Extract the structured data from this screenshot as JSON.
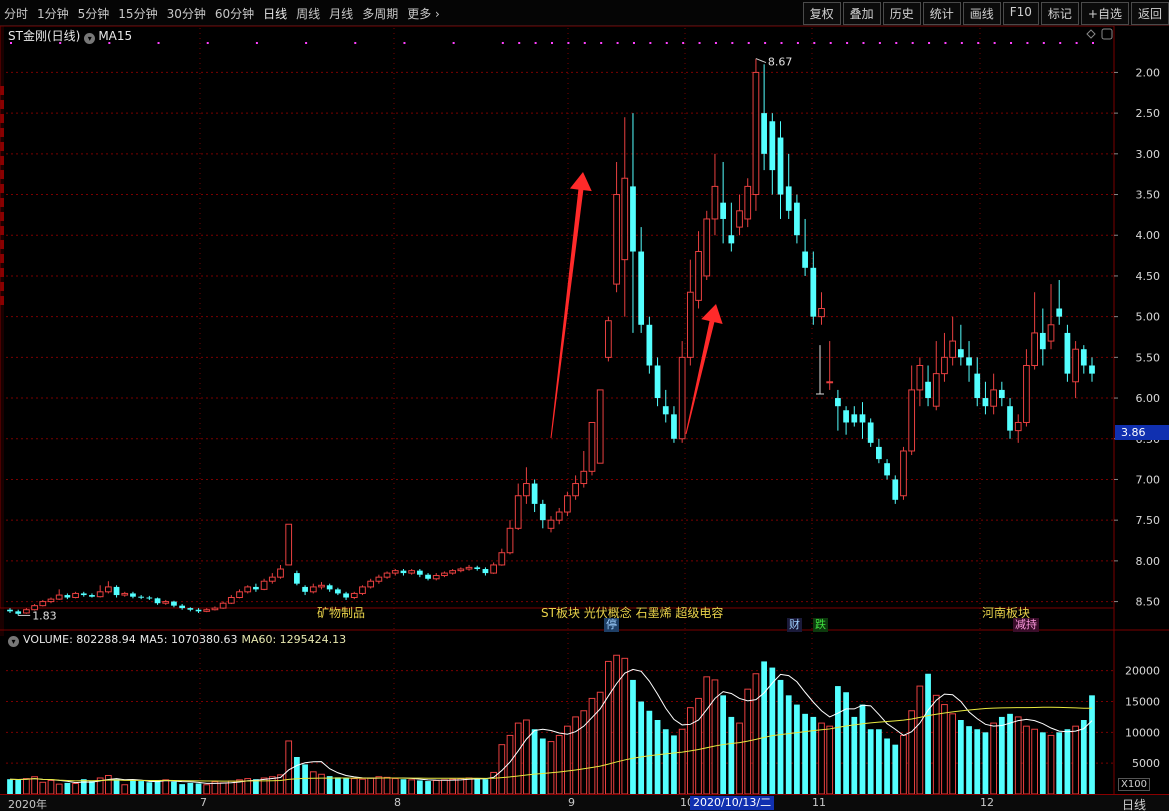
{
  "toolbar": {
    "periods": [
      "分时",
      "1分钟",
      "5分钟",
      "15分钟",
      "30分钟",
      "60分钟",
      "日线",
      "周线",
      "月线",
      "多周期",
      "更多"
    ],
    "active_period": "日线",
    "right_tabs": [
      "复权",
      "叠加",
      "历史",
      "统计",
      "画线",
      "F10",
      "标记",
      "+自选",
      "返回"
    ]
  },
  "price_panel": {
    "stock_title": "ST金刚(日线)",
    "indicator": "MA15",
    "high_label": "8.67",
    "low_label": "1.83",
    "current_price_tag": "3.86",
    "y_ticks": [
      "8.50",
      "8.00",
      "7.50",
      "7.00",
      "6.50",
      "6.00",
      "5.50",
      "5.00",
      "4.50",
      "4.00",
      "3.50",
      "3.00",
      "2.50",
      "2.00"
    ],
    "annotations": {
      "sector1": "矿物制品",
      "sector2": "ST板块 光伏概念 石墨烯 超级电容",
      "sector3": "河南板块"
    },
    "event_chips": {
      "stop": "停",
      "finance": "财",
      "fall": "跌",
      "reduce": "减持"
    }
  },
  "volume_panel": {
    "volume_label": "VOLUME: 802288.94",
    "ma5_label": "MA5: 1070380.63",
    "ma60_label": "MA60: 1295424.13",
    "y_ticks": [
      "20000",
      "15000",
      "10000",
      "5000"
    ],
    "unit": "X100"
  },
  "bottom_bar": {
    "x_labels": [
      "2020年",
      "7",
      "8",
      "9",
      "10",
      "11",
      "12"
    ],
    "cursor_date": "2020/10/13/二",
    "period_label": "日线"
  },
  "colors": {
    "up": "#e84040",
    "down": "#54ffff",
    "ma_line": "#ffffff",
    "ma60_line": "#e8e840",
    "arrow": "#ff2a2a",
    "grid": "#7a0000"
  },
  "chart_data": [
    {
      "type": "candlestick",
      "title": "ST金刚(日线)",
      "ylim": [
        1.7,
        8.8
      ],
      "y_ticks": [
        2.0,
        2.5,
        3.0,
        3.5,
        4.0,
        4.5,
        5.0,
        5.5,
        6.0,
        6.5,
        7.0,
        7.5,
        8.0,
        8.5
      ],
      "date_labels": [
        "2020年",
        "7",
        "8",
        "9",
        "10",
        "11",
        "12"
      ],
      "candles": [
        [
          1.9,
          1.88,
          1.92,
          1.86
        ],
        [
          1.88,
          1.85,
          1.9,
          1.83
        ],
        [
          1.86,
          1.9,
          1.92,
          1.85
        ],
        [
          1.9,
          1.95,
          1.97,
          1.89
        ],
        [
          1.95,
          2.0,
          2.02,
          1.94
        ],
        [
          2.0,
          2.03,
          2.05,
          1.98
        ],
        [
          2.03,
          2.08,
          2.15,
          2.02
        ],
        [
          2.08,
          2.05,
          2.1,
          2.03
        ],
        [
          2.05,
          2.1,
          2.12,
          2.04
        ],
        [
          2.1,
          2.08,
          2.12,
          2.06
        ],
        [
          2.08,
          2.06,
          2.1,
          2.05
        ],
        [
          2.06,
          2.12,
          2.2,
          2.05
        ],
        [
          2.12,
          2.18,
          2.25,
          2.1
        ],
        [
          2.18,
          2.08,
          2.2,
          2.05
        ],
        [
          2.08,
          2.1,
          2.12,
          2.06
        ],
        [
          2.1,
          2.06,
          2.12,
          2.04
        ],
        [
          2.06,
          2.05,
          2.08,
          2.03
        ],
        [
          2.05,
          2.04,
          2.07,
          2.02
        ],
        [
          2.04,
          1.98,
          2.05,
          1.96
        ],
        [
          1.98,
          2.0,
          2.02,
          1.96
        ],
        [
          2.0,
          1.95,
          2.01,
          1.93
        ],
        [
          1.95,
          1.92,
          1.97,
          1.9
        ],
        [
          1.92,
          1.9,
          1.93,
          1.88
        ],
        [
          1.9,
          1.88,
          1.92,
          1.86
        ],
        [
          1.88,
          1.9,
          1.92,
          1.87
        ],
        [
          1.9,
          1.92,
          1.94,
          1.89
        ],
        [
          1.92,
          1.98,
          2.0,
          1.91
        ],
        [
          1.98,
          2.05,
          2.08,
          1.97
        ],
        [
          2.05,
          2.12,
          2.15,
          2.04
        ],
        [
          2.12,
          2.18,
          2.2,
          2.1
        ],
        [
          2.18,
          2.15,
          2.22,
          2.12
        ],
        [
          2.15,
          2.25,
          2.28,
          2.14
        ],
        [
          2.25,
          2.3,
          2.35,
          2.22
        ],
        [
          2.3,
          2.4,
          2.45,
          2.28
        ],
        [
          2.45,
          2.95,
          2.95,
          2.45
        ],
        [
          2.35,
          2.22,
          2.38,
          2.2
        ],
        [
          2.18,
          2.12,
          2.2,
          2.08
        ],
        [
          2.12,
          2.18,
          2.22,
          2.1
        ],
        [
          2.18,
          2.2,
          2.24,
          2.15
        ],
        [
          2.2,
          2.15,
          2.22,
          2.12
        ],
        [
          2.15,
          2.1,
          2.17,
          2.08
        ],
        [
          2.1,
          2.05,
          2.12,
          2.02
        ],
        [
          2.05,
          2.1,
          2.12,
          2.03
        ],
        [
          2.1,
          2.18,
          2.2,
          2.08
        ],
        [
          2.18,
          2.25,
          2.28,
          2.16
        ],
        [
          2.25,
          2.3,
          2.33,
          2.22
        ],
        [
          2.3,
          2.35,
          2.37,
          2.28
        ],
        [
          2.35,
          2.38,
          2.4,
          2.32
        ],
        [
          2.38,
          2.35,
          2.4,
          2.32
        ],
        [
          2.35,
          2.38,
          2.4,
          2.33
        ],
        [
          2.38,
          2.33,
          2.4,
          2.3
        ],
        [
          2.33,
          2.28,
          2.35,
          2.26
        ],
        [
          2.28,
          2.32,
          2.35,
          2.26
        ],
        [
          2.32,
          2.35,
          2.37,
          2.3
        ],
        [
          2.35,
          2.38,
          2.4,
          2.33
        ],
        [
          2.38,
          2.4,
          2.42,
          2.36
        ],
        [
          2.4,
          2.42,
          2.45,
          2.38
        ],
        [
          2.42,
          2.4,
          2.44,
          2.38
        ],
        [
          2.4,
          2.35,
          2.42,
          2.32
        ],
        [
          2.35,
          2.45,
          2.48,
          2.34
        ],
        [
          2.45,
          2.6,
          2.65,
          2.44
        ],
        [
          2.6,
          2.9,
          3.0,
          2.58
        ],
        [
          2.9,
          3.3,
          3.45,
          2.88
        ],
        [
          3.3,
          3.45,
          3.65,
          3.2
        ],
        [
          3.45,
          3.2,
          3.5,
          3.1
        ],
        [
          3.2,
          3.0,
          3.25,
          2.9
        ],
        [
          2.9,
          3.0,
          3.05,
          2.85
        ],
        [
          3.0,
          3.1,
          3.15,
          2.95
        ],
        [
          3.1,
          3.3,
          3.35,
          3.05
        ],
        [
          3.3,
          3.45,
          3.55,
          3.25
        ],
        [
          3.45,
          3.6,
          3.85,
          3.4
        ],
        [
          3.6,
          4.2,
          4.2,
          3.55
        ],
        [
          3.7,
          4.6,
          4.6,
          3.7
        ],
        [
          5.0,
          5.45,
          5.5,
          4.95
        ],
        [
          5.9,
          7.0,
          7.4,
          5.8
        ],
        [
          6.2,
          7.2,
          7.95,
          5.5
        ],
        [
          7.1,
          6.3,
          8.0,
          5.3
        ],
        [
          6.3,
          5.4,
          6.6,
          5.3
        ],
        [
          5.4,
          4.9,
          5.5,
          4.8
        ],
        [
          4.9,
          4.5,
          5.0,
          4.4
        ],
        [
          4.4,
          4.3,
          4.6,
          4.2
        ],
        [
          4.3,
          4.0,
          4.4,
          3.95
        ],
        [
          4.0,
          5.0,
          5.2,
          3.95
        ],
        [
          5.0,
          5.8,
          6.2,
          4.9
        ],
        [
          5.7,
          6.3,
          6.55,
          5.6
        ],
        [
          6.0,
          6.7,
          6.8,
          5.95
        ],
        [
          6.7,
          7.1,
          7.5,
          6.5
        ],
        [
          6.9,
          6.7,
          7.4,
          6.4
        ],
        [
          6.5,
          6.4,
          6.9,
          6.3
        ],
        [
          6.6,
          6.8,
          7.0,
          6.5
        ],
        [
          6.7,
          7.1,
          7.2,
          6.6
        ],
        [
          7.0,
          8.5,
          8.67,
          6.8
        ],
        [
          8.0,
          7.5,
          8.6,
          7.3
        ],
        [
          7.9,
          7.3,
          8.0,
          7.0
        ],
        [
          7.7,
          7.0,
          7.9,
          6.7
        ],
        [
          7.1,
          6.8,
          7.5,
          6.7
        ],
        [
          6.9,
          6.5,
          7.0,
          6.4
        ],
        [
          6.3,
          6.1,
          6.7,
          6.0
        ],
        [
          6.1,
          5.5,
          6.3,
          5.4
        ],
        [
          5.5,
          5.6,
          5.8,
          5.4
        ],
        [
          4.7,
          4.7,
          5.2,
          4.6
        ],
        [
          4.5,
          4.4,
          4.6,
          4.1
        ],
        [
          4.35,
          4.2,
          4.4,
          4.05
        ],
        [
          4.3,
          4.2,
          4.4,
          4.15
        ],
        [
          4.3,
          4.2,
          4.45,
          4.0
        ],
        [
          4.2,
          3.95,
          4.25,
          3.9
        ],
        [
          3.9,
          3.75,
          4.0,
          3.7
        ],
        [
          3.7,
          3.55,
          3.75,
          3.5
        ],
        [
          3.5,
          3.25,
          3.55,
          3.2
        ],
        [
          3.3,
          3.85,
          3.9,
          3.25
        ],
        [
          3.85,
          4.6,
          4.9,
          3.8
        ],
        [
          4.6,
          4.9,
          5.0,
          4.4
        ],
        [
          4.7,
          4.5,
          4.9,
          4.4
        ],
        [
          4.4,
          4.8,
          5.2,
          4.35
        ],
        [
          4.8,
          5.0,
          5.3,
          4.7
        ],
        [
          5.0,
          5.2,
          5.5,
          4.9
        ],
        [
          5.1,
          5.0,
          5.4,
          4.9
        ],
        [
          5.0,
          4.9,
          5.2,
          4.7
        ],
        [
          4.8,
          4.5,
          5.0,
          4.4
        ],
        [
          4.5,
          4.4,
          4.7,
          4.3
        ],
        [
          4.4,
          4.6,
          4.8,
          4.3
        ],
        [
          4.6,
          4.5,
          4.7,
          4.4
        ],
        [
          4.4,
          4.1,
          4.5,
          4.0
        ],
        [
          4.1,
          4.2,
          4.3,
          3.95
        ],
        [
          4.2,
          4.9,
          5.1,
          4.15
        ],
        [
          4.9,
          5.3,
          5.8,
          4.85
        ],
        [
          5.3,
          5.1,
          5.6,
          4.9
        ],
        [
          5.2,
          5.4,
          5.9,
          5.1
        ],
        [
          5.6,
          5.5,
          5.95,
          5.4
        ],
        [
          5.3,
          4.8,
          5.4,
          4.7
        ],
        [
          4.7,
          5.1,
          5.2,
          4.5
        ],
        [
          5.1,
          4.9,
          5.15,
          4.8
        ],
        [
          4.9,
          4.8,
          5.0,
          4.7
        ]
      ]
    },
    {
      "type": "bar",
      "title": "VOLUME",
      "ylim": [
        0,
        24000
      ],
      "y_ticks": [
        5000,
        10000,
        15000,
        20000
      ],
      "series": [
        {
          "name": "VOLUME",
          "values": [
            2400,
            2300,
            2500,
            2800,
            1900,
            2200,
            1600,
            1800,
            1700,
            2400,
            2100,
            2600,
            3000,
            2400,
            1500,
            2300,
            2100,
            1900,
            2200,
            2300,
            2000,
            1600,
            1800,
            1700,
            1500,
            2000,
            1800,
            2100,
            2300,
            2500,
            2400,
            2600,
            2800,
            3100,
            8600,
            6000,
            4800,
            3600,
            3200,
            2900,
            2700,
            2600,
            2500,
            2400,
            2600,
            2800,
            2700,
            2500,
            2400,
            2300,
            2200,
            2100,
            2200,
            2300,
            2400,
            2500,
            2600,
            2500,
            2400,
            3500,
            8000,
            9500,
            11500,
            12000,
            10500,
            9000,
            8500,
            9500,
            11000,
            12500,
            13500,
            15500,
            16500,
            21500,
            22500,
            22000,
            18500,
            15000,
            13500,
            12000,
            10500,
            9500,
            10500,
            14000,
            15500,
            19000,
            18500,
            16000,
            12500,
            11500,
            17000,
            19500,
            21500,
            20500,
            18500,
            16000,
            14500,
            13000,
            12500,
            11500,
            11000,
            17500,
            16500,
            12500,
            14500,
            10500,
            10500,
            9000,
            8000,
            9500,
            13500,
            17500,
            19500,
            16000,
            14500,
            13000,
            12000,
            11000,
            10500,
            10000,
            11500,
            12500,
            13000,
            12500,
            11000,
            10500,
            10000,
            9500,
            10000,
            10500,
            11000,
            12000,
            16000,
            19000,
            13000,
            12000,
            11000,
            10500,
            9000,
            8000
          ]
        },
        {
          "name": "MA5",
          "values": []
        },
        {
          "name": "MA60",
          "values": []
        }
      ]
    }
  ]
}
